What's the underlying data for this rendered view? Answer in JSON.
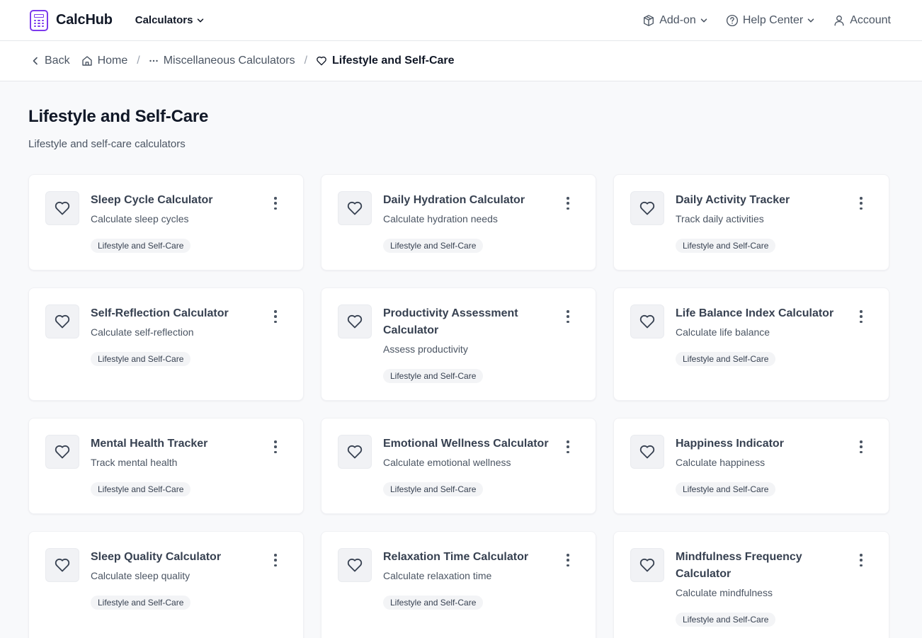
{
  "brand": {
    "name": "CalcHub",
    "accent": "#7c3aed"
  },
  "nav": {
    "calculators": "Calculators",
    "addon": "Add-on",
    "help": "Help Center",
    "account": "Account"
  },
  "breadcrumb": {
    "back": "Back",
    "home": "Home",
    "parent": "Miscellaneous Calculators",
    "current": "Lifestyle and Self-Care"
  },
  "page": {
    "title": "Lifestyle and Self-Care",
    "subtitle": "Lifestyle and self-care calculators"
  },
  "cards": [
    {
      "title": "Sleep Cycle Calculator",
      "desc": "Calculate sleep cycles",
      "tag": "Lifestyle and Self-Care",
      "icon": "heart-icon"
    },
    {
      "title": "Daily Hydration Calculator",
      "desc": "Calculate hydration needs",
      "tag": "Lifestyle and Self-Care",
      "icon": "heart-icon"
    },
    {
      "title": "Daily Activity Tracker",
      "desc": "Track daily activities",
      "tag": "Lifestyle and Self-Care",
      "icon": "heart-icon"
    },
    {
      "title": "Self-Reflection Calculator",
      "desc": "Calculate self-reflection",
      "tag": "Lifestyle and Self-Care",
      "icon": "heart-icon"
    },
    {
      "title": "Productivity Assessment Calculator",
      "desc": "Assess productivity",
      "tag": "Lifestyle and Self-Care",
      "icon": "heart-icon"
    },
    {
      "title": "Life Balance Index Calculator",
      "desc": "Calculate life balance",
      "tag": "Lifestyle and Self-Care",
      "icon": "heart-icon"
    },
    {
      "title": "Mental Health Tracker",
      "desc": "Track mental health",
      "tag": "Lifestyle and Self-Care",
      "icon": "heart-icon"
    },
    {
      "title": "Emotional Wellness Calculator",
      "desc": "Calculate emotional wellness",
      "tag": "Lifestyle and Self-Care",
      "icon": "heart-icon"
    },
    {
      "title": "Happiness Indicator",
      "desc": "Calculate happiness",
      "tag": "Lifestyle and Self-Care",
      "icon": "heart-icon"
    },
    {
      "title": "Sleep Quality Calculator",
      "desc": "Calculate sleep quality",
      "tag": "Lifestyle and Self-Care",
      "icon": "heart-icon"
    },
    {
      "title": "Relaxation Time Calculator",
      "desc": "Calculate relaxation time",
      "tag": "Lifestyle and Self-Care",
      "icon": "heart-icon"
    },
    {
      "title": "Mindfulness Frequency Calculator",
      "desc": "Calculate mindfulness",
      "tag": "Lifestyle and Self-Care",
      "icon": "heart-icon"
    }
  ]
}
